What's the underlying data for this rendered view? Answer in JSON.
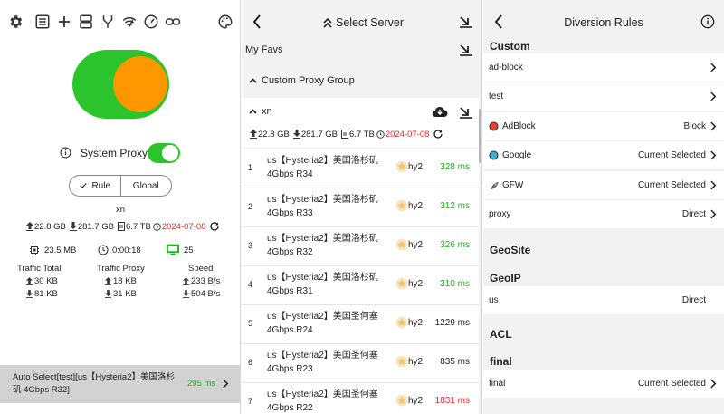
{
  "p1": {
    "toolbar_icons": [
      "gear-icon",
      "list-icon",
      "plus-icon",
      "storage-icon",
      "fork-icon",
      "wifi-speed-icon",
      "speedometer-icon",
      "link-icon",
      "palette-icon"
    ],
    "system_proxy_label": "System Proxy",
    "mode": {
      "rule": "Rule",
      "global": "Global",
      "selected": "Rule"
    },
    "profile_name": "xn",
    "usage": {
      "upload": "22.8 GB",
      "download": "281.7 GB",
      "total": "6.7 TB",
      "expiry": "2024-07-08"
    },
    "memory": "23.5 MB",
    "uptime": "0:00:18",
    "connections": "25",
    "traffic_total": {
      "label": "Traffic Total",
      "up": "30 KB",
      "down": "81 KB"
    },
    "traffic_proxy": {
      "label": "Traffic Proxy",
      "up": "18 KB",
      "down": "31 KB"
    },
    "speed": {
      "label": "Speed",
      "up": "233 B/s",
      "down": "504 B/s"
    },
    "auto_select": {
      "line1": "Auto Select[test][us【Hysteria2】美国洛杉",
      "line2": "矶 4Gbps R32]",
      "latency": "295 ms"
    }
  },
  "p2": {
    "title": "Select Server",
    "my_favs": "My Favs",
    "custom_group": "Custom Proxy Group",
    "group_name": "xn",
    "usage": {
      "upload": "22.8 GB",
      "download": "281.7 GB",
      "total": "6.7 TB",
      "expiry": "2024-07-08"
    },
    "servers": [
      {
        "n": "1",
        "l1": "us【Hysteria2】美国洛杉矶",
        "l2": "4Gbps R34",
        "proto": "hy2",
        "lat": "328 ms",
        "c": "#22aa22"
      },
      {
        "n": "2",
        "l1": "us【Hysteria2】美国洛杉矶",
        "l2": "4Gbps R33",
        "proto": "hy2",
        "lat": "312 ms",
        "c": "#22aa22"
      },
      {
        "n": "3",
        "l1": "us【Hysteria2】美国洛杉矶",
        "l2": "4Gbps R32",
        "proto": "hy2",
        "lat": "326 ms",
        "c": "#22aa22"
      },
      {
        "n": "4",
        "l1": "us【Hysteria2】美国洛杉矶",
        "l2": "4Gbps R31",
        "proto": "hy2",
        "lat": "310 ms",
        "c": "#22aa22"
      },
      {
        "n": "5",
        "l1": "us【Hysteria2】美国圣何塞",
        "l2": "4Gbps R24",
        "proto": "hy2",
        "lat": "1229 ms",
        "c": "#222222"
      },
      {
        "n": "6",
        "l1": "us【Hysteria2】美国圣何塞",
        "l2": "4Gbps R23",
        "proto": "hy2",
        "lat": "835 ms",
        "c": "#222222"
      },
      {
        "n": "7",
        "l1": "us【Hysteria2】美国圣何塞",
        "l2": "4Gbps R22",
        "proto": "hy2",
        "lat": "1831 ms",
        "c": "#e03030"
      }
    ]
  },
  "p3": {
    "title": "Diversion Rules",
    "custom": "Custom",
    "rules": [
      {
        "label": "ad-block",
        "value": "",
        "icon": ""
      },
      {
        "label": "test",
        "value": "",
        "icon": ""
      },
      {
        "label": "AdBlock",
        "value": "Block",
        "icon": "red-dot-icon"
      },
      {
        "label": "Google",
        "value": "Current Selected",
        "icon": "globe-icon"
      },
      {
        "label": "GFW",
        "value": "Current Selected",
        "icon": "rocket-icon"
      },
      {
        "label": "proxy",
        "value": "Direct",
        "icon": ""
      }
    ],
    "geosite": "GeoSite",
    "geoip": "GeoIP",
    "geoip_row": {
      "label": "us",
      "value": "Direct"
    },
    "acl": "ACL",
    "final_h": "final",
    "final_row": {
      "label": "final",
      "value": "Current Selected"
    }
  }
}
